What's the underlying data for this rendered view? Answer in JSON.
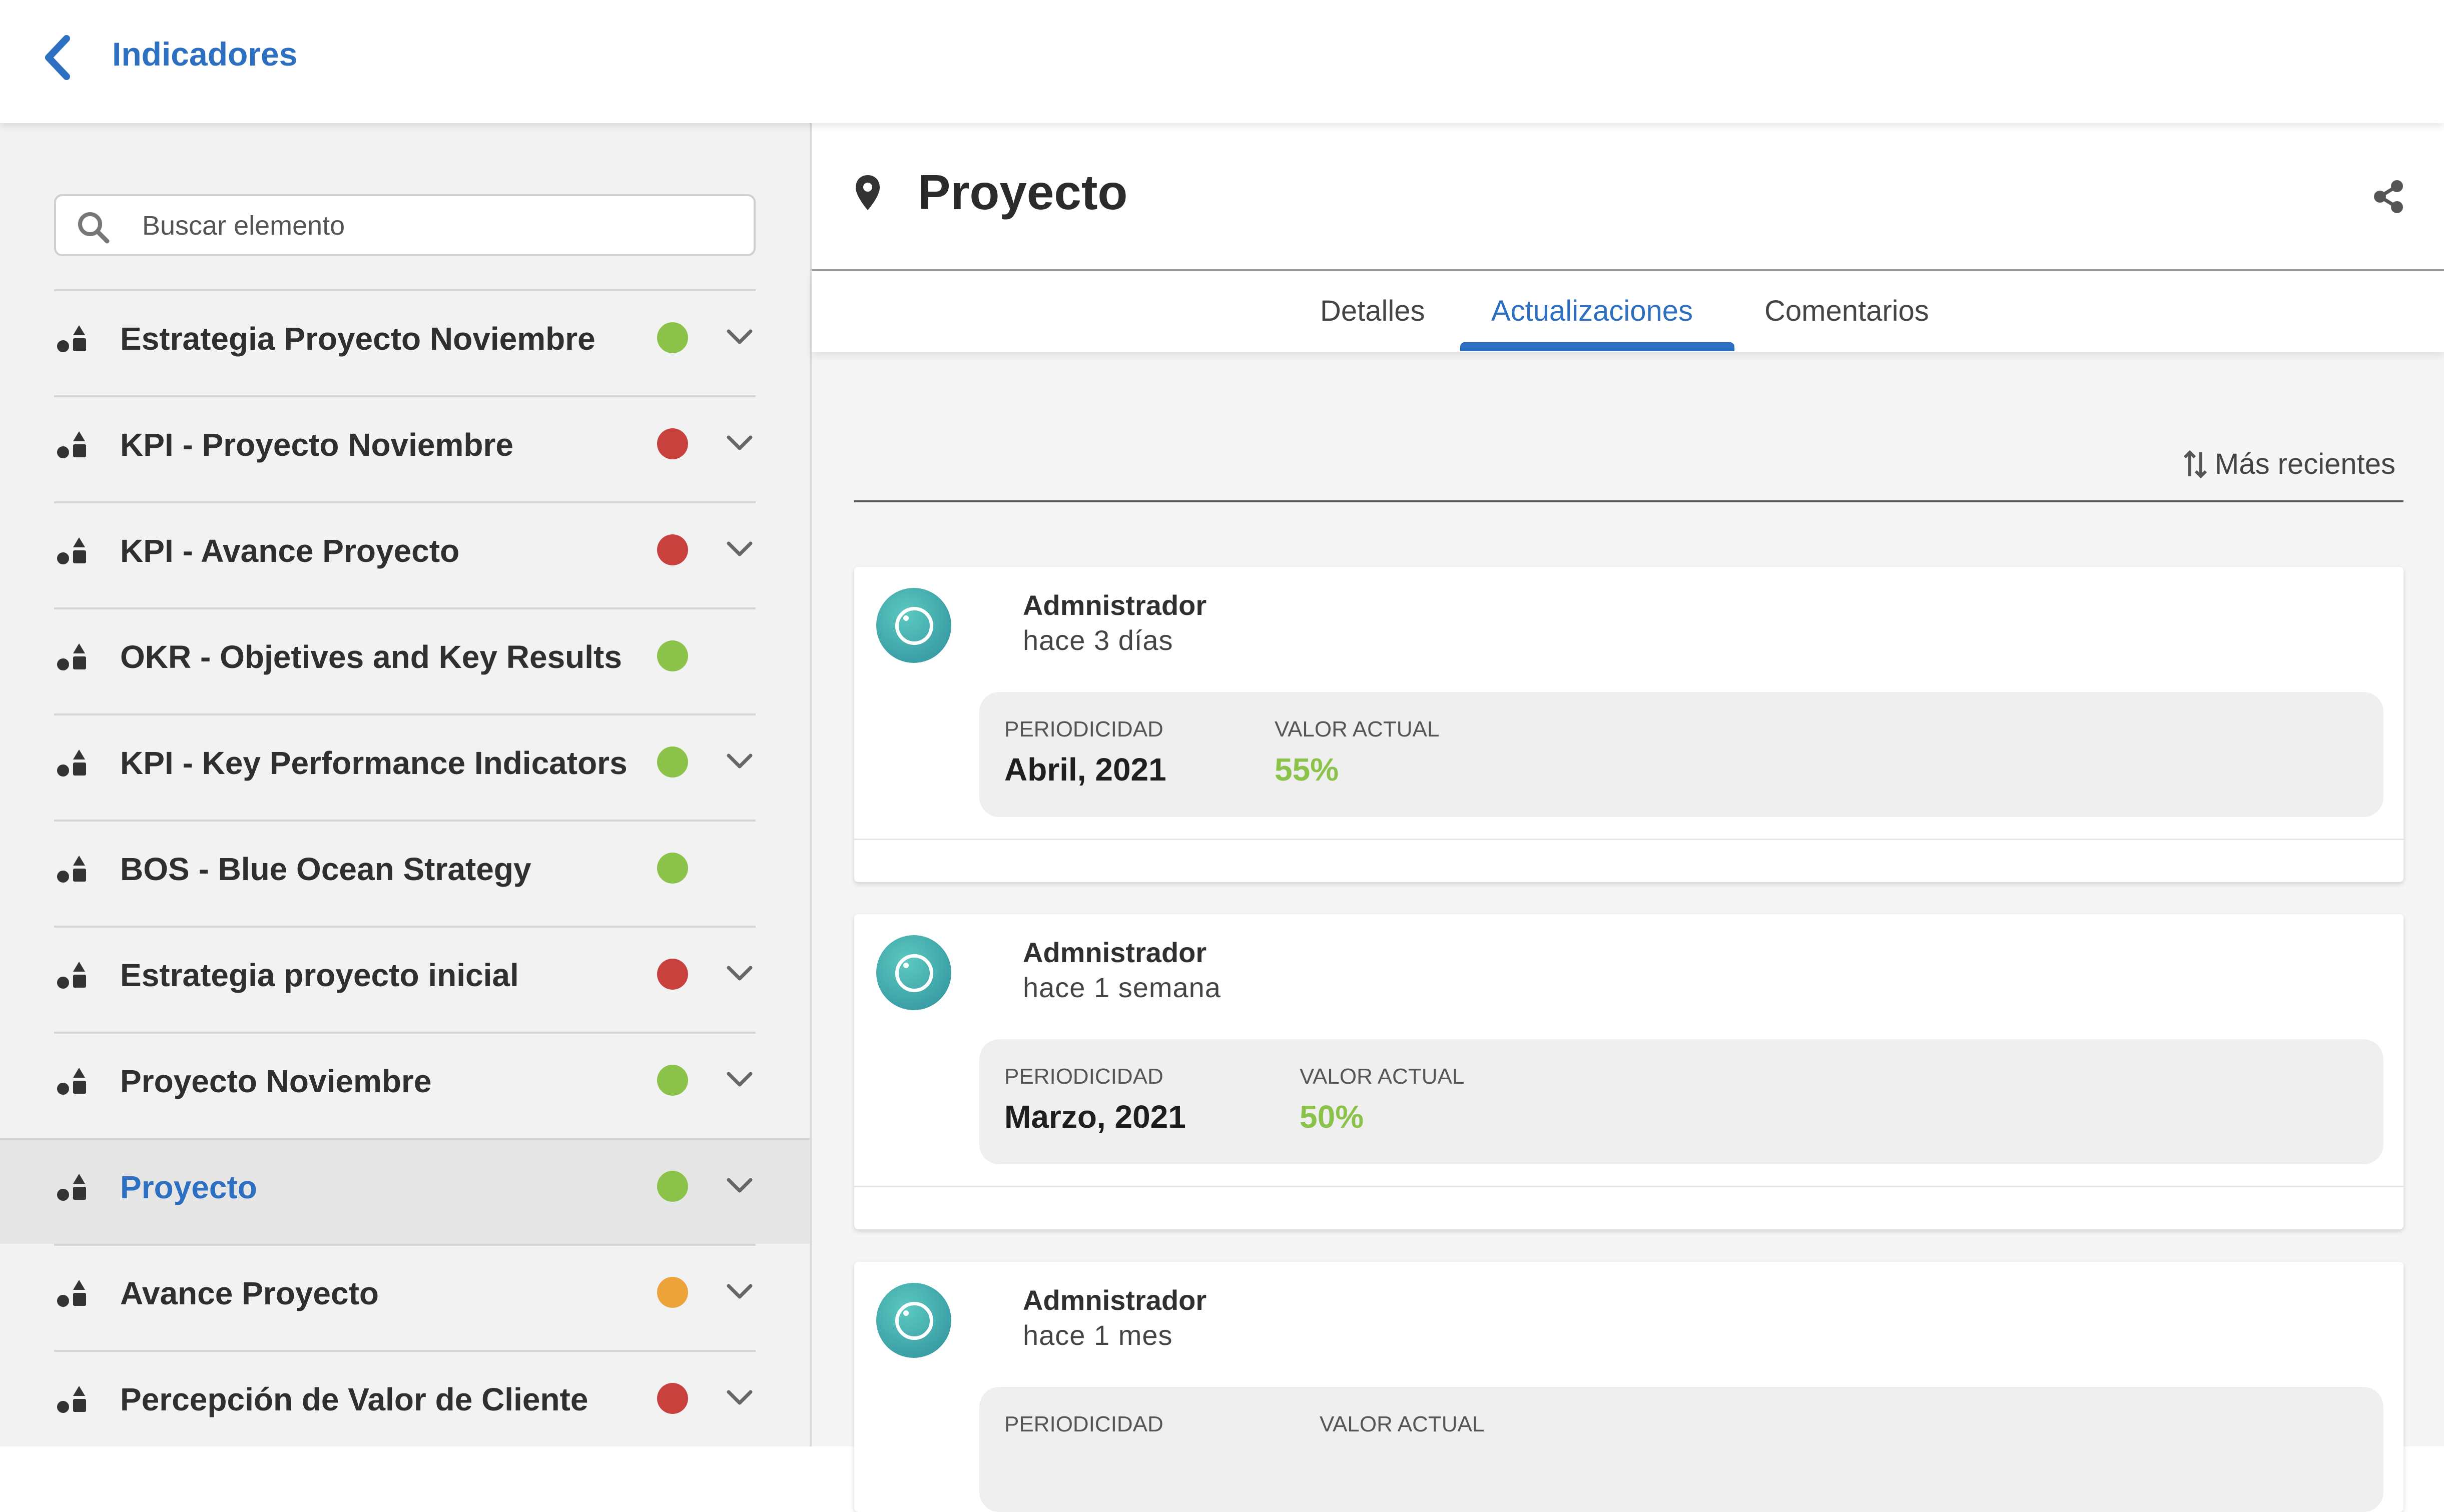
{
  "header": {
    "title": "Indicadores"
  },
  "search": {
    "placeholder": "Buscar elemento"
  },
  "sidebar": {
    "items": [
      {
        "label": "Estrategia Proyecto Noviembre",
        "status": "#8bc34a",
        "expandable": true
      },
      {
        "label": "KPI - Proyecto Noviembre",
        "status": "#c9413d",
        "expandable": true
      },
      {
        "label": "KPI - Avance Proyecto",
        "status": "#c9413d",
        "expandable": true
      },
      {
        "label": "OKR - Objetives and Key Results",
        "status": "#8bc34a",
        "expandable": false
      },
      {
        "label": "KPI - Key Performance Indicators",
        "status": "#8bc34a",
        "expandable": true
      },
      {
        "label": "BOS - Blue Ocean Strategy",
        "status": "#8bc34a",
        "expandable": false
      },
      {
        "label": "Estrategia proyecto inicial",
        "status": "#c9413d",
        "expandable": true
      },
      {
        "label": "Proyecto Noviembre",
        "status": "#8bc34a",
        "expandable": true
      },
      {
        "label": "Proyecto",
        "status": "#8bc34a",
        "expandable": true,
        "active": true
      },
      {
        "label": "Avance Proyecto",
        "status": "#eba33a",
        "expandable": true
      },
      {
        "label": "Percepción de Valor de Cliente",
        "status": "#c9413d",
        "expandable": true
      }
    ]
  },
  "main": {
    "title": "Proyecto",
    "tabs": [
      {
        "label": "Detalles"
      },
      {
        "label": "Actualizaciones",
        "active": true
      },
      {
        "label": "Comentarios"
      }
    ],
    "sort_label": "Más recientes",
    "updates": [
      {
        "author": "Admnistrador",
        "when": "hace 3 días",
        "period_label": "PERIODICIDAD",
        "period": "Abril, 2021",
        "value_label": "VALOR ACTUAL",
        "value": "55%"
      },
      {
        "author": "Admnistrador",
        "when": "hace 1 semana",
        "period_label": "PERIODICIDAD",
        "period": "Marzo, 2021",
        "value_label": "VALOR ACTUAL",
        "value": "50%"
      },
      {
        "author": "Admnistrador",
        "when": "hace 1 mes",
        "period_label": "PERIODICIDAD",
        "period": "",
        "value_label": "VALOR ACTUAL",
        "value": ""
      }
    ]
  },
  "colors": {
    "accent": "#2d6fc1",
    "ok": "#8bc34a",
    "bad": "#c9413d",
    "warn": "#eba33a"
  },
  "icons": {
    "back": "chevron-left-icon",
    "search": "search-icon",
    "item": "shapes-icon",
    "expand": "chevron-down-icon",
    "location": "location-pin-icon",
    "share": "share-icon",
    "sort": "sort-arrows-icon"
  }
}
